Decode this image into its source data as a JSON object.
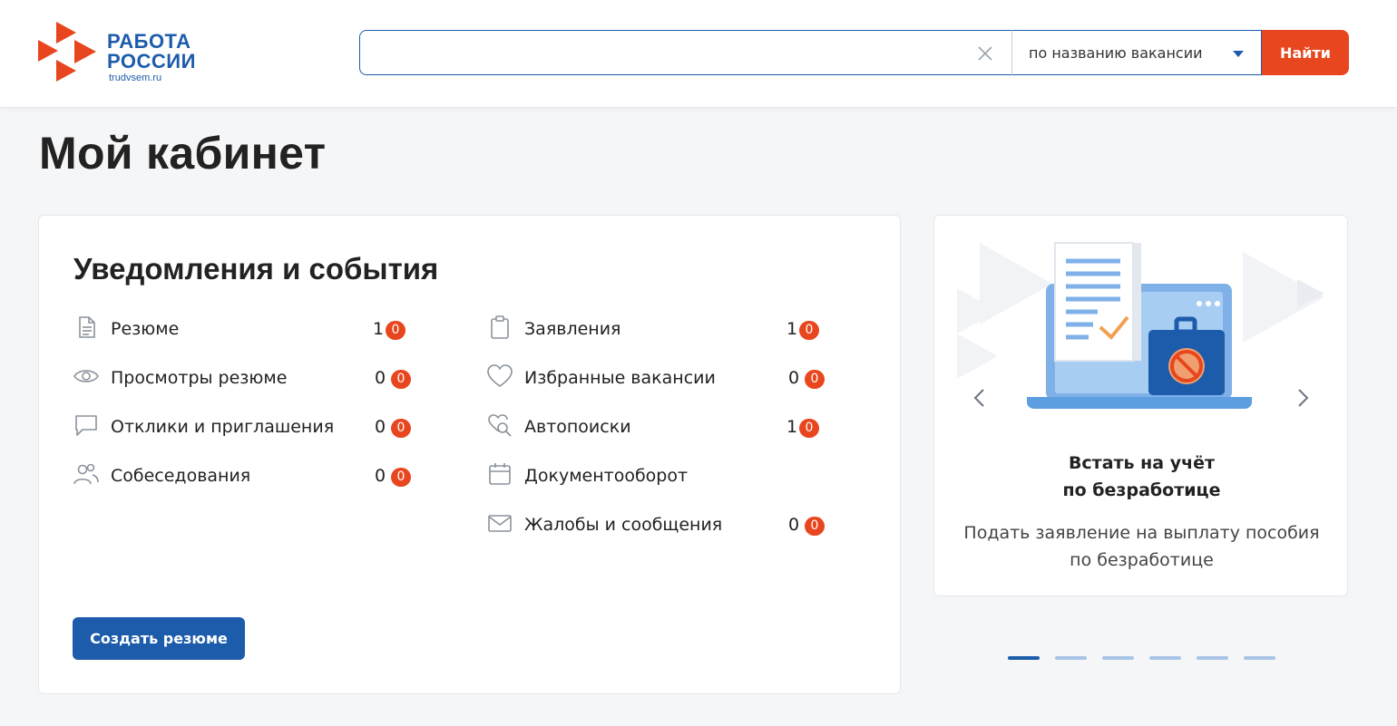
{
  "header": {
    "logo": {
      "line1": "РАБОТА",
      "line2": "РОССИИ",
      "domain": "trudvsem.ru"
    },
    "search": {
      "value": "",
      "placeholder": "",
      "mode_label": "по названию вакансии",
      "submit_label": "Найти"
    }
  },
  "page": {
    "title": "Мой кабинет"
  },
  "notifications": {
    "title": "Уведомления и события",
    "left_items": [
      {
        "label": "Резюме",
        "count": "1",
        "badge": "0",
        "icon": "document-icon"
      },
      {
        "label": "Просмотры резюме",
        "count": "0",
        "badge": "0",
        "icon": "eye-icon"
      },
      {
        "label": "Отклики и приглашения",
        "count": "0",
        "badge": "0",
        "icon": "chat-icon"
      },
      {
        "label": "Собеседования",
        "count": "0",
        "badge": "0",
        "icon": "people-icon"
      }
    ],
    "right_items": [
      {
        "label": "Заявления",
        "count": "1",
        "badge": "0",
        "icon": "clipboard-icon"
      },
      {
        "label": "Избранные вакансии",
        "count": "0",
        "badge": "0",
        "icon": "heart-icon"
      },
      {
        "label": "Автопоиски",
        "count": "1",
        "badge": "0",
        "icon": "heart-search-icon"
      },
      {
        "label": "Документооборот",
        "count": "",
        "badge": "",
        "icon": "calendar-icon"
      },
      {
        "label": "Жалобы и сообщения",
        "count": "0",
        "badge": "0",
        "icon": "mail-icon"
      }
    ],
    "create_resume_label": "Создать резюме"
  },
  "promo": {
    "title_line1": "Встать на учёт",
    "title_line2": "по безработице",
    "text_line1": "Подать заявление на выплату пособия",
    "text_line2": "по безработице",
    "slides_total": 6,
    "active_slide": 1
  },
  "colors": {
    "brand_blue": "#1c5cab",
    "accent_orange": "#e8461e",
    "background": "#f5f6f8"
  }
}
